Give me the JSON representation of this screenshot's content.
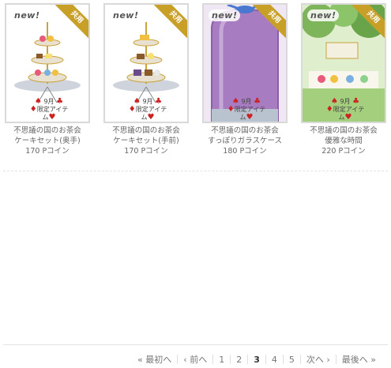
{
  "items": [
    {
      "new_label": "new!",
      "corner_label": "共用",
      "badge_month": "9月",
      "badge_text": "限定アイテム",
      "name": "不思議の国のお茶会",
      "sub": "ケーキセット(奥手)",
      "price": "170 Pコイン"
    },
    {
      "new_label": "new!",
      "corner_label": "共用",
      "badge_month": "9月",
      "badge_text": "限定アイテム",
      "name": "不思議の国のお茶会",
      "sub": "ケーキセット(手前)",
      "price": "170 Pコイン"
    },
    {
      "new_label": "new!",
      "corner_label": "共用",
      "badge_month": "9月",
      "badge_text": "限定アイテム",
      "name": "不思議の国のお茶会",
      "sub": "すっぽりガラスケース",
      "price": "180 Pコイン"
    },
    {
      "new_label": "new!",
      "corner_label": "共用",
      "badge_month": "9月",
      "badge_text": "限定アイテム",
      "name": "不思議の国のお茶会",
      "sub": "優雅な時間",
      "price": "220 Pコイン"
    }
  ],
  "pager": {
    "first": "« 最初へ",
    "prev": "‹ 前へ",
    "pages": [
      "1",
      "2",
      "3",
      "4",
      "5"
    ],
    "next": "次へ ›",
    "last": "最後へ »"
  },
  "colors": {
    "corner": "#c8a028",
    "glass": "#a77cc0",
    "forest": "#7fb55a"
  }
}
